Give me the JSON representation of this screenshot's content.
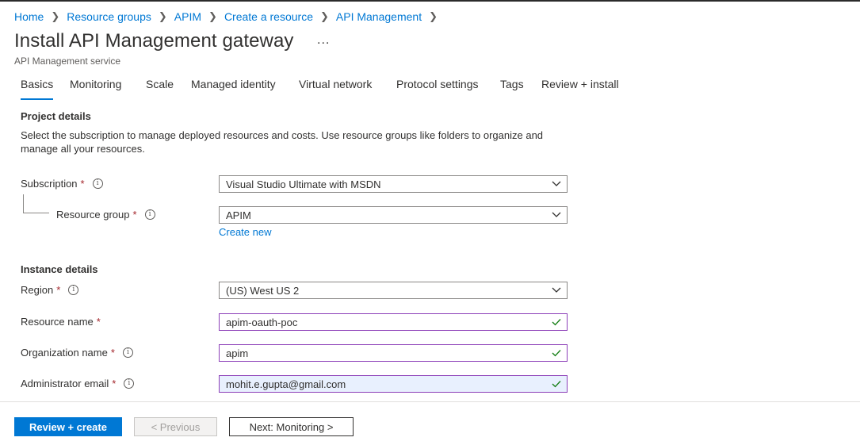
{
  "breadcrumb": [
    "Home",
    "Resource groups",
    "APIM",
    "Create a resource",
    "API Management"
  ],
  "page": {
    "title": "Install API Management gateway",
    "more_label": "...",
    "subtitle": "API Management service"
  },
  "tabs": [
    "Basics",
    "Monitoring",
    "Scale",
    "Managed identity",
    "Virtual network",
    "Protocol settings",
    "Tags",
    "Review + install"
  ],
  "active_tab": "Basics",
  "project": {
    "title": "Project details",
    "description": "Select the subscription to manage deployed resources and costs. Use resource groups like folders to organize and manage all your resources.",
    "subscription_label": "Subscription",
    "subscription_value": "Visual Studio Ultimate with MSDN",
    "resource_group_label": "Resource group",
    "resource_group_value": "APIM",
    "create_new": "Create new"
  },
  "instance": {
    "title": "Instance details",
    "region_label": "Region",
    "region_value": "(US) West US 2",
    "resource_name_label": "Resource name",
    "resource_name_value": "apim-oauth-poc",
    "org_name_label": "Organization name",
    "org_name_value": "apim",
    "admin_email_label": "Administrator email",
    "admin_email_value": "mohit.e.gupta@gmail.com"
  },
  "required_marker": "*",
  "info_glyph": "i",
  "footer": {
    "review_create": "Review + create",
    "previous": "< Previous",
    "next": "Next: Monitoring >"
  },
  "colors": {
    "accent": "#0078d4",
    "required": "#a4262c",
    "valid_border": "#8c3fb8",
    "valid_check": "#107c10"
  }
}
